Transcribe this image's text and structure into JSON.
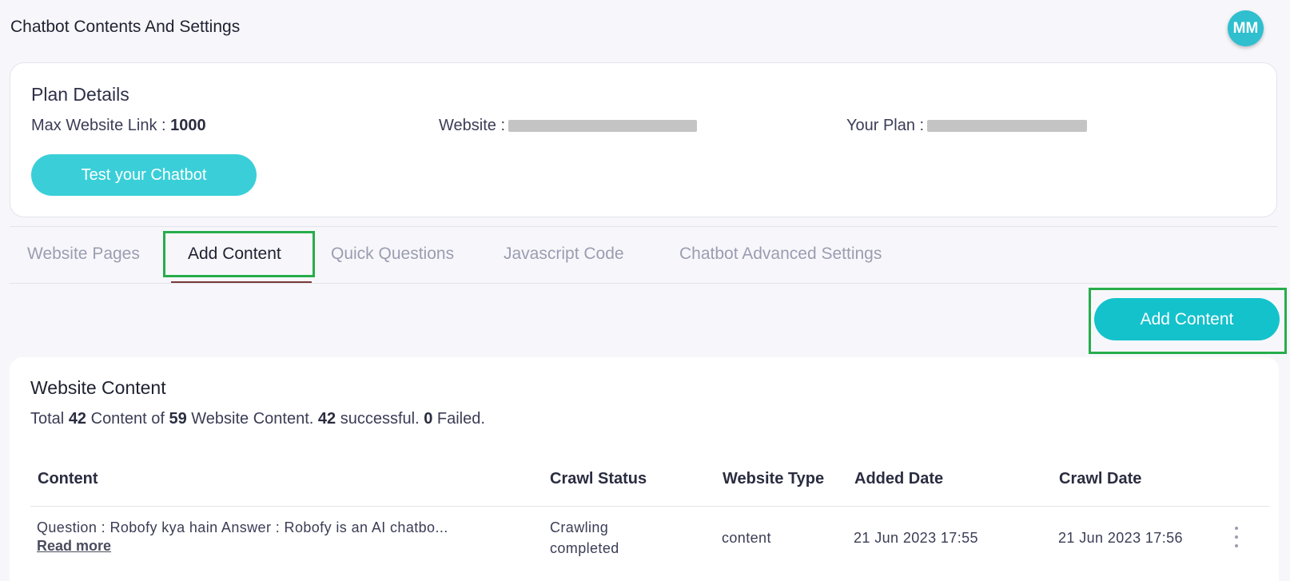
{
  "header": {
    "title": "Chatbot Contents And Settings",
    "avatar_initials": "MM"
  },
  "plan": {
    "title": "Plan Details",
    "max_link_label": "Max Website Link : ",
    "max_link_value": "1000",
    "website_label": "Website :",
    "your_plan_label": "Your Plan :",
    "test_button": "Test your Chatbot"
  },
  "tabs": [
    {
      "label": "Website Pages"
    },
    {
      "label": "Add Content"
    },
    {
      "label": "Quick Questions"
    },
    {
      "label": "Javascript Code"
    },
    {
      "label": "Chatbot Advanced Settings"
    }
  ],
  "add_content_button": "Add Content",
  "content": {
    "title": "Website Content",
    "summary": {
      "t1": "Total ",
      "n1": "42",
      "t2": " Content of ",
      "n2": "59",
      "t3": " Website Content. ",
      "n3": "42",
      "t4": " successful. ",
      "n4": "0",
      "t5": " Failed."
    },
    "columns": [
      "Content",
      "Crawl Status",
      "Website Type",
      "Added Date",
      "Crawl Date"
    ],
    "rows": [
      {
        "content": "Question : Robofy kya hain Answer : Robofy is an AI chatbo...",
        "read_more": "Read more",
        "status_line1": "Crawling",
        "status_line2": "completed",
        "type": "content",
        "added": "21 Jun 2023 17:55",
        "crawled": "21 Jun 2023 17:56"
      }
    ]
  },
  "colors": {
    "accent": "#14c2cc",
    "highlight": "#27ad4b",
    "avatar": "#2fbfcf"
  }
}
